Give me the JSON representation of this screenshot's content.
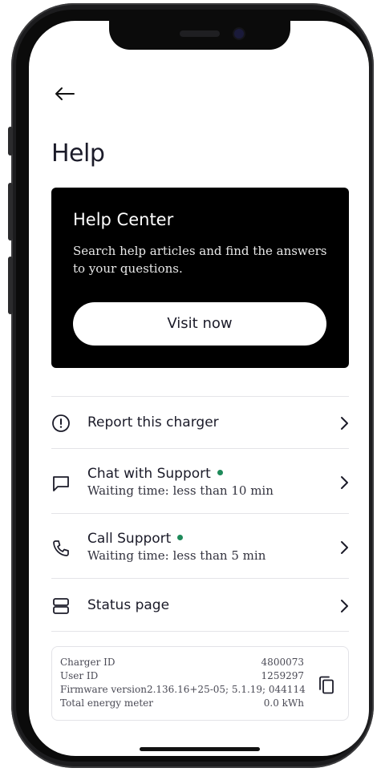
{
  "header": {
    "back_icon": "arrow-left-icon",
    "title": "Help"
  },
  "help_center": {
    "title": "Help Center",
    "description": "Search help articles and find the answers to your questions.",
    "button_label": "Visit now"
  },
  "menu": [
    {
      "icon": "alert-circle-icon",
      "label": "Report this charger",
      "subtitle": "",
      "online": false
    },
    {
      "icon": "chat-bubble-icon",
      "label": "Chat with Support",
      "subtitle": "Waiting time: less than 10 min",
      "online": true
    },
    {
      "icon": "phone-icon",
      "label": "Call Support",
      "subtitle": "Waiting time: less than 5 min",
      "online": true
    },
    {
      "icon": "server-icon",
      "label": "Status page",
      "subtitle": "",
      "online": false
    }
  ],
  "status_dot_color": "#1e8a5a",
  "info": {
    "charger_id_label": "Charger ID",
    "charger_id": "4800073",
    "user_id_label": "User ID",
    "user_id": "1259297",
    "firmware_label": "Firmware version",
    "firmware": "2.136.16+25-05; 5.1.19; 044114",
    "energy_label": "Total energy meter",
    "energy": "0.0 kWh",
    "copy_icon": "copy-icon"
  }
}
